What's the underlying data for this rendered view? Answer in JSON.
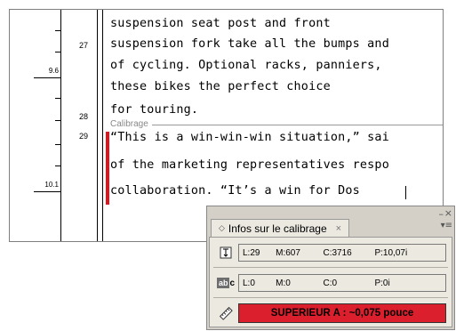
{
  "editor": {
    "ruler_labels": [
      "9.6",
      "10.1"
    ],
    "line_numbers": [
      "27",
      "28",
      "29"
    ],
    "text_lines": [
      "suspension seat post and front",
      "suspension fork take all the bumps and",
      "of cycling. Optional racks, panniers,",
      "these bikes the perfect choice",
      "for touring.",
      "“This is a win-win-win situation,” sai",
      "of the marketing representatives respo",
      "collaboration. “It’s a win for Dos"
    ],
    "overset_label": "Calibrage"
  },
  "panel": {
    "tab_title": "Infos sur le calibrage",
    "row1": {
      "lines": "L:29",
      "words": "M:607",
      "chars": "C:3716",
      "depth": "P:10,07i"
    },
    "row2": {
      "lines": "L:0",
      "words": "M:0",
      "chars": "C:0",
      "depth": "P:0i"
    },
    "row3": {
      "warning": "SUPERIEUR A :  ~0,075 pouce"
    },
    "icons": [
      "depth-icon",
      "abc-icon",
      "ruler-icon"
    ]
  },
  "colors": {
    "overset_red": "#e0141c",
    "warning_red": "#dc1f2d"
  }
}
